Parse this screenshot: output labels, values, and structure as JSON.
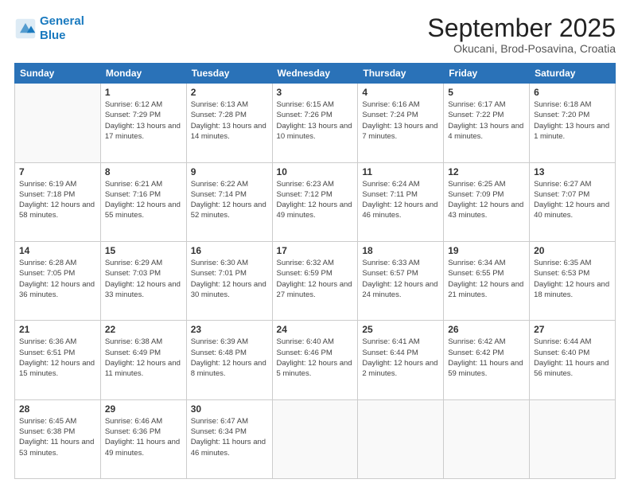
{
  "logo": {
    "line1": "General",
    "line2": "Blue"
  },
  "title": "September 2025",
  "subtitle": "Okucani, Brod-Posavina, Croatia",
  "days_header": [
    "Sunday",
    "Monday",
    "Tuesday",
    "Wednesday",
    "Thursday",
    "Friday",
    "Saturday"
  ],
  "weeks": [
    [
      {
        "day": "",
        "sunrise": "",
        "sunset": "",
        "daylight": ""
      },
      {
        "day": "1",
        "sunrise": "Sunrise: 6:12 AM",
        "sunset": "Sunset: 7:29 PM",
        "daylight": "Daylight: 13 hours and 17 minutes."
      },
      {
        "day": "2",
        "sunrise": "Sunrise: 6:13 AM",
        "sunset": "Sunset: 7:28 PM",
        "daylight": "Daylight: 13 hours and 14 minutes."
      },
      {
        "day": "3",
        "sunrise": "Sunrise: 6:15 AM",
        "sunset": "Sunset: 7:26 PM",
        "daylight": "Daylight: 13 hours and 10 minutes."
      },
      {
        "day": "4",
        "sunrise": "Sunrise: 6:16 AM",
        "sunset": "Sunset: 7:24 PM",
        "daylight": "Daylight: 13 hours and 7 minutes."
      },
      {
        "day": "5",
        "sunrise": "Sunrise: 6:17 AM",
        "sunset": "Sunset: 7:22 PM",
        "daylight": "Daylight: 13 hours and 4 minutes."
      },
      {
        "day": "6",
        "sunrise": "Sunrise: 6:18 AM",
        "sunset": "Sunset: 7:20 PM",
        "daylight": "Daylight: 13 hours and 1 minute."
      }
    ],
    [
      {
        "day": "7",
        "sunrise": "Sunrise: 6:19 AM",
        "sunset": "Sunset: 7:18 PM",
        "daylight": "Daylight: 12 hours and 58 minutes."
      },
      {
        "day": "8",
        "sunrise": "Sunrise: 6:21 AM",
        "sunset": "Sunset: 7:16 PM",
        "daylight": "Daylight: 12 hours and 55 minutes."
      },
      {
        "day": "9",
        "sunrise": "Sunrise: 6:22 AM",
        "sunset": "Sunset: 7:14 PM",
        "daylight": "Daylight: 12 hours and 52 minutes."
      },
      {
        "day": "10",
        "sunrise": "Sunrise: 6:23 AM",
        "sunset": "Sunset: 7:12 PM",
        "daylight": "Daylight: 12 hours and 49 minutes."
      },
      {
        "day": "11",
        "sunrise": "Sunrise: 6:24 AM",
        "sunset": "Sunset: 7:11 PM",
        "daylight": "Daylight: 12 hours and 46 minutes."
      },
      {
        "day": "12",
        "sunrise": "Sunrise: 6:25 AM",
        "sunset": "Sunset: 7:09 PM",
        "daylight": "Daylight: 12 hours and 43 minutes."
      },
      {
        "day": "13",
        "sunrise": "Sunrise: 6:27 AM",
        "sunset": "Sunset: 7:07 PM",
        "daylight": "Daylight: 12 hours and 40 minutes."
      }
    ],
    [
      {
        "day": "14",
        "sunrise": "Sunrise: 6:28 AM",
        "sunset": "Sunset: 7:05 PM",
        "daylight": "Daylight: 12 hours and 36 minutes."
      },
      {
        "day": "15",
        "sunrise": "Sunrise: 6:29 AM",
        "sunset": "Sunset: 7:03 PM",
        "daylight": "Daylight: 12 hours and 33 minutes."
      },
      {
        "day": "16",
        "sunrise": "Sunrise: 6:30 AM",
        "sunset": "Sunset: 7:01 PM",
        "daylight": "Daylight: 12 hours and 30 minutes."
      },
      {
        "day": "17",
        "sunrise": "Sunrise: 6:32 AM",
        "sunset": "Sunset: 6:59 PM",
        "daylight": "Daylight: 12 hours and 27 minutes."
      },
      {
        "day": "18",
        "sunrise": "Sunrise: 6:33 AM",
        "sunset": "Sunset: 6:57 PM",
        "daylight": "Daylight: 12 hours and 24 minutes."
      },
      {
        "day": "19",
        "sunrise": "Sunrise: 6:34 AM",
        "sunset": "Sunset: 6:55 PM",
        "daylight": "Daylight: 12 hours and 21 minutes."
      },
      {
        "day": "20",
        "sunrise": "Sunrise: 6:35 AM",
        "sunset": "Sunset: 6:53 PM",
        "daylight": "Daylight: 12 hours and 18 minutes."
      }
    ],
    [
      {
        "day": "21",
        "sunrise": "Sunrise: 6:36 AM",
        "sunset": "Sunset: 6:51 PM",
        "daylight": "Daylight: 12 hours and 15 minutes."
      },
      {
        "day": "22",
        "sunrise": "Sunrise: 6:38 AM",
        "sunset": "Sunset: 6:49 PM",
        "daylight": "Daylight: 12 hours and 11 minutes."
      },
      {
        "day": "23",
        "sunrise": "Sunrise: 6:39 AM",
        "sunset": "Sunset: 6:48 PM",
        "daylight": "Daylight: 12 hours and 8 minutes."
      },
      {
        "day": "24",
        "sunrise": "Sunrise: 6:40 AM",
        "sunset": "Sunset: 6:46 PM",
        "daylight": "Daylight: 12 hours and 5 minutes."
      },
      {
        "day": "25",
        "sunrise": "Sunrise: 6:41 AM",
        "sunset": "Sunset: 6:44 PM",
        "daylight": "Daylight: 12 hours and 2 minutes."
      },
      {
        "day": "26",
        "sunrise": "Sunrise: 6:42 AM",
        "sunset": "Sunset: 6:42 PM",
        "daylight": "Daylight: 11 hours and 59 minutes."
      },
      {
        "day": "27",
        "sunrise": "Sunrise: 6:44 AM",
        "sunset": "Sunset: 6:40 PM",
        "daylight": "Daylight: 11 hours and 56 minutes."
      }
    ],
    [
      {
        "day": "28",
        "sunrise": "Sunrise: 6:45 AM",
        "sunset": "Sunset: 6:38 PM",
        "daylight": "Daylight: 11 hours and 53 minutes."
      },
      {
        "day": "29",
        "sunrise": "Sunrise: 6:46 AM",
        "sunset": "Sunset: 6:36 PM",
        "daylight": "Daylight: 11 hours and 49 minutes."
      },
      {
        "day": "30",
        "sunrise": "Sunrise: 6:47 AM",
        "sunset": "Sunset: 6:34 PM",
        "daylight": "Daylight: 11 hours and 46 minutes."
      },
      {
        "day": "",
        "sunrise": "",
        "sunset": "",
        "daylight": ""
      },
      {
        "day": "",
        "sunrise": "",
        "sunset": "",
        "daylight": ""
      },
      {
        "day": "",
        "sunrise": "",
        "sunset": "",
        "daylight": ""
      },
      {
        "day": "",
        "sunrise": "",
        "sunset": "",
        "daylight": ""
      }
    ]
  ]
}
